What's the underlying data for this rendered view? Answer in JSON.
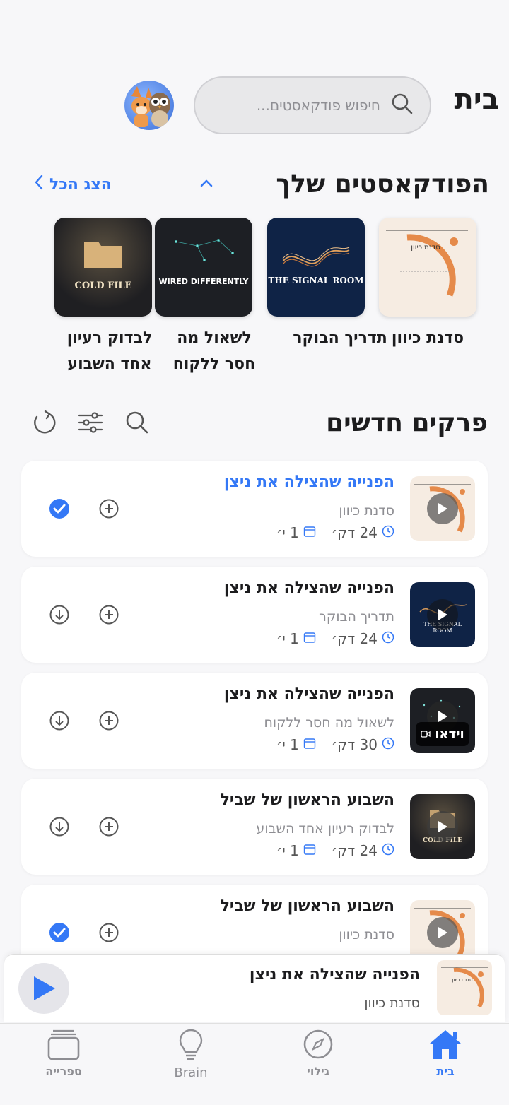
{
  "header": {
    "title": "בית",
    "search_placeholder": "חיפוש פודקאסטים..."
  },
  "podcasts_section": {
    "title": "הפודקאסטים שלך",
    "show_all": "הצג הכל",
    "items": [
      {
        "label": "סדנת כיוון",
        "cover_text": "סדנת כיוון"
      },
      {
        "label": "תדריך הבוקר",
        "cover_text": "THE SIGNAL ROOM"
      },
      {
        "label": "לשאול מה חסר ללקוח",
        "cover_text": "WIRED DIFFERENTLY"
      },
      {
        "label": "לבדוק רעיון אחד השבוע",
        "cover_text": "COLD FILE"
      }
    ]
  },
  "episodes_section": {
    "title": "פרקים חדשים",
    "episodes": [
      {
        "title": "הפנייה שהצילה את ניצן",
        "show": "סדנת כיוון",
        "duration": "24 דק׳",
        "date": "1 י׳",
        "active": true,
        "downloaded": true
      },
      {
        "title": "הפנייה שהצילה את ניצן",
        "show": "תדריך הבוקר",
        "duration": "24 דק׳",
        "date": "1 י׳",
        "active": false,
        "downloaded": false
      },
      {
        "title": "הפנייה שהצילה את ניצן",
        "show": "לשאול מה חסר ללקוח",
        "duration": "30 דק׳",
        "date": "1 י׳",
        "active": false,
        "downloaded": false,
        "badge": "וידאו"
      },
      {
        "title": "השבוע הראשון של שביל",
        "show": "לבדוק רעיון אחד השבוע",
        "duration": "24 דק׳",
        "date": "1 י׳",
        "active": false,
        "downloaded": false
      },
      {
        "title": "השבוע הראשון של שביל",
        "show": "סדנת כיוון",
        "active": false,
        "downloaded": true
      }
    ]
  },
  "mini_player": {
    "title": "הפנייה שהצילה את ניצן",
    "show": "סדנת כיוון"
  },
  "tabbar": {
    "home": "בית",
    "discover": "גילוי",
    "brain": "Brain",
    "library": "ספרייה"
  },
  "colors": {
    "accent": "#3478f6",
    "cover_cream": "#f6ece2",
    "cover_orange": "#e58a4a",
    "cover_navy": "#0f2346",
    "cover_dark": "#1d1f24"
  }
}
